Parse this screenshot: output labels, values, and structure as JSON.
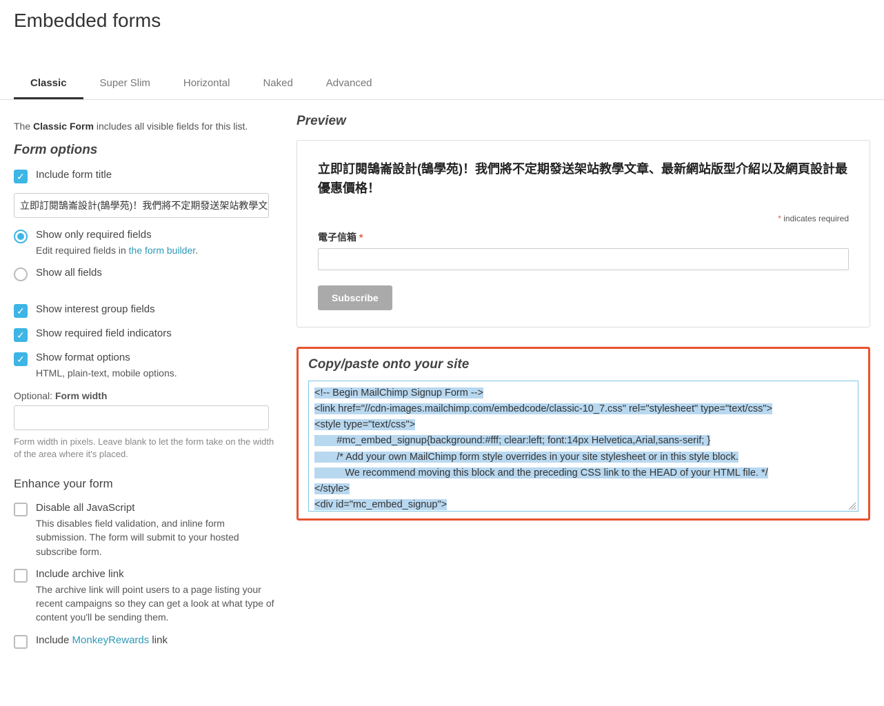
{
  "page_title": "Embedded forms",
  "tabs": [
    "Classic",
    "Super Slim",
    "Horizontal",
    "Naked",
    "Advanced"
  ],
  "active_tab": 0,
  "intro": {
    "prefix": "The ",
    "bold": "Classic Form",
    "suffix": " includes all visible fields for this list."
  },
  "sections": {
    "form_options": "Form options",
    "enhance": "Enhance your form"
  },
  "options": {
    "include_title": "Include form title",
    "title_value": "立即訂閱鵠崙設計(鵠學苑)！我們將不定期發送架站教學文",
    "only_required": "Show only required fields",
    "only_required_desc_prefix": "Edit required fields in ",
    "only_required_link": "the form builder",
    "show_all": "Show all fields",
    "interest_groups": "Show interest group fields",
    "required_indicators": "Show required field indicators",
    "format_options": "Show format options",
    "format_desc": "HTML, plain-text, mobile options.",
    "width_label_prefix": "Optional: ",
    "width_label_bold": "Form width",
    "width_help": "Form width in pixels. Leave blank to let the form take on the width of the area where it's placed.",
    "disable_js": "Disable all JavaScript",
    "disable_js_desc": "This disables field validation, and inline form submission. The form will submit to your hosted subscribe form.",
    "archive": "Include archive link",
    "archive_desc": "The archive link will point users to a page listing your recent campaigns so they can get a look at what type of content you'll be sending them.",
    "monkey_prefix": "Include ",
    "monkey_link": "MonkeyRewards",
    "monkey_suffix": " link"
  },
  "preview": {
    "heading": "Preview",
    "title": "立即訂閱鵠崙設計(鵠學苑)！我們將不定期發送架站教學文章、最新網站版型介紹以及網頁設計最優惠價格！",
    "indicates": "indicates required",
    "email_label": "電子信箱",
    "subscribe": "Subscribe"
  },
  "code": {
    "heading": "Copy/paste onto your site",
    "lines": [
      "<!-- Begin MailChimp Signup Form -->",
      "<link href=\"//cdn-images.mailchimp.com/embedcode/classic-10_7.css\" rel=\"stylesheet\" type=\"text/css\">",
      "<style type=\"text/css\">",
      "        #mc_embed_signup{background:#fff; clear:left; font:14px Helvetica,Arial,sans-serif; }",
      "        /* Add your own MailChimp form style overrides in your site stylesheet or in this style block.",
      "           We recommend moving this block and the preceding CSS link to the HEAD of your HTML file. */",
      "</style>",
      "<div id=\"mc_embed_signup\">"
    ]
  }
}
